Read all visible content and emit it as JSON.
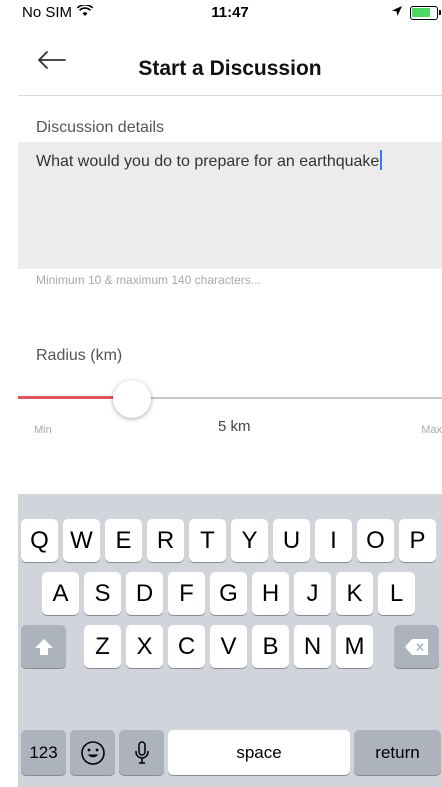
{
  "status_bar": {
    "carrier": "No SIM",
    "time": "11:47"
  },
  "nav": {
    "title": "Start a Discussion"
  },
  "details": {
    "label": "Discussion details",
    "value": "What would you do to prepare for an earthquake",
    "hint": "Minimum 10 & maximum 140 characters..."
  },
  "radius": {
    "label": "Radius (km)",
    "min_label": "Min",
    "max_label": "Max",
    "value_label": "5 km",
    "fraction": 0.27
  },
  "keyboard": {
    "row1": [
      "Q",
      "W",
      "E",
      "R",
      "T",
      "Y",
      "U",
      "I",
      "O",
      "P"
    ],
    "row2": [
      "A",
      "S",
      "D",
      "F",
      "G",
      "H",
      "J",
      "K",
      "L"
    ],
    "row3": [
      "Z",
      "X",
      "C",
      "V",
      "B",
      "N",
      "M"
    ],
    "numbers_key": "123",
    "space_key": "space",
    "return_key": "return"
  },
  "colors": {
    "slider_fill": "#e0575a",
    "caret": "#3478f6",
    "battery": "#4cd964"
  }
}
